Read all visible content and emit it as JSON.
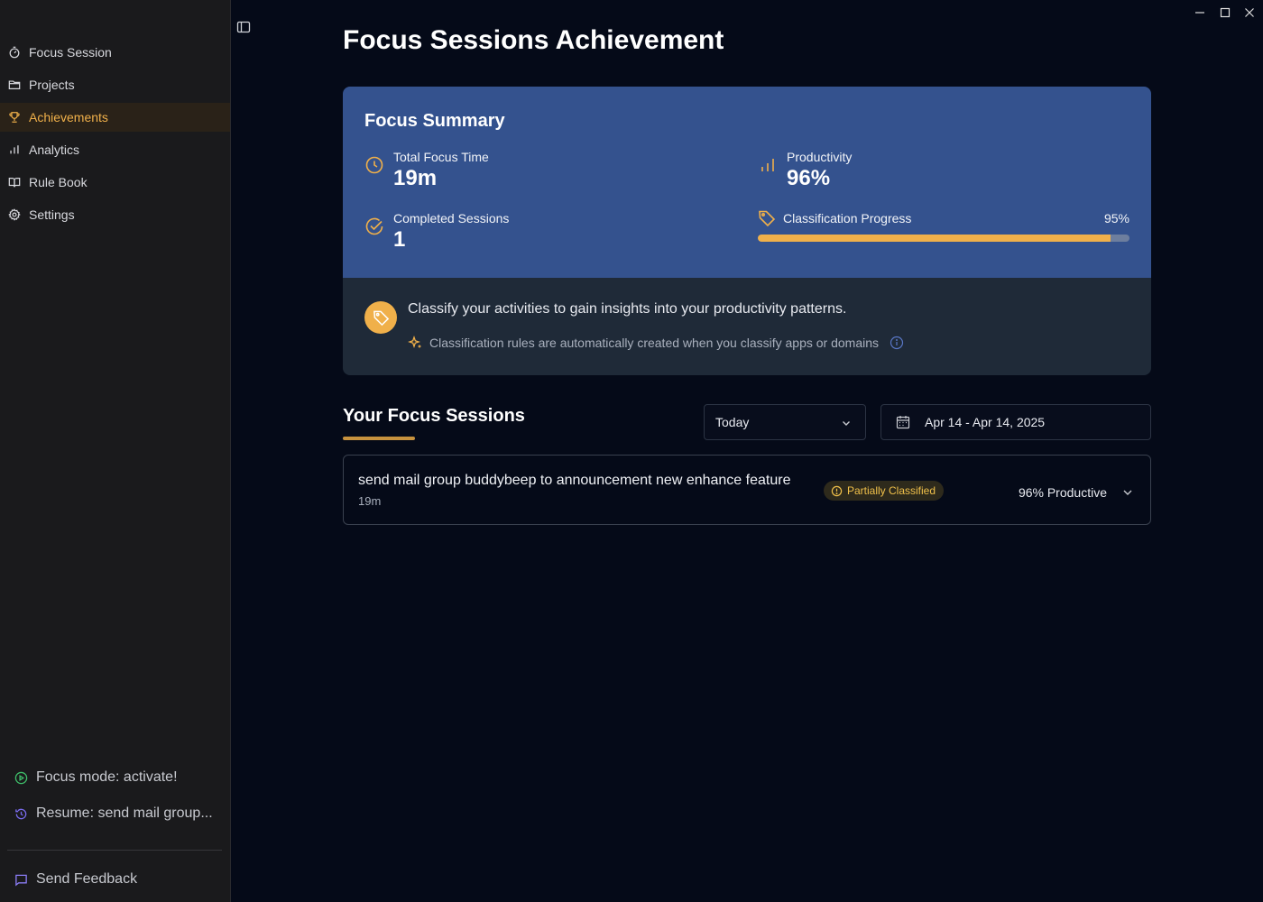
{
  "sidebar": {
    "items": [
      {
        "label": "Focus Session",
        "icon": "timer-icon",
        "active": false
      },
      {
        "label": "Projects",
        "icon": "folder-icon",
        "active": false
      },
      {
        "label": "Achievements",
        "icon": "trophy-icon",
        "active": true
      },
      {
        "label": "Analytics",
        "icon": "bar-chart-icon",
        "active": false
      },
      {
        "label": "Rule Book",
        "icon": "book-icon",
        "active": false
      },
      {
        "label": "Settings",
        "icon": "gear-icon",
        "active": false
      }
    ],
    "focus_mode_label": "Focus mode: activate!",
    "resume_label": "Resume: send mail group...",
    "feedback_label": "Send Feedback"
  },
  "page": {
    "title": "Focus Sessions Achievement"
  },
  "summary": {
    "title": "Focus Summary",
    "total_focus_time_label": "Total Focus Time",
    "total_focus_time_value": "19m",
    "productivity_label": "Productivity",
    "productivity_value": "96%",
    "completed_sessions_label": "Completed Sessions",
    "completed_sessions_value": "1",
    "classification_progress_label": "Classification Progress",
    "classification_progress_text": "95%",
    "classification_progress_fraction": 0.95
  },
  "info": {
    "main": "Classify your activities to gain insights into your productivity patterns.",
    "sub": "Classification rules are automatically created when you classify apps or domains"
  },
  "sessions": {
    "title": "Your Focus Sessions",
    "filter_selected": "Today",
    "date_range": "Apr 14 - Apr 14, 2025",
    "items": [
      {
        "title": "send mail group buddybeep to announcement new enhance feature",
        "duration": "19m",
        "badge": "Partially Classified",
        "productive": "96% Productive"
      }
    ]
  },
  "colors": {
    "accent": "#f0b04a",
    "summary_bg": "#34528e",
    "app_bg": "#050a18",
    "sidebar_bg": "#1a1a1c"
  }
}
